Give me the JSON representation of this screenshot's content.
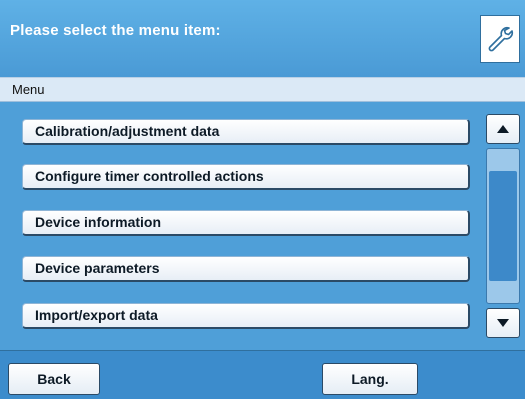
{
  "header": {
    "title": "Please select the menu item:",
    "tool_icon": "wrench-icon"
  },
  "subheader": {
    "label": "Menu"
  },
  "menu": {
    "items": [
      {
        "label": "Calibration/adjustment data"
      },
      {
        "label": "Configure timer controlled actions"
      },
      {
        "label": "Device information"
      },
      {
        "label": "Device parameters"
      },
      {
        "label": "Import/export data"
      }
    ]
  },
  "scroll": {
    "up_icon": "arrow-up-icon",
    "down_icon": "arrow-down-icon"
  },
  "footer": {
    "back_label": "Back",
    "lang_label": "Lang."
  },
  "colors": {
    "accent": "#4f9fd8",
    "footer": "#3c8ccc"
  }
}
